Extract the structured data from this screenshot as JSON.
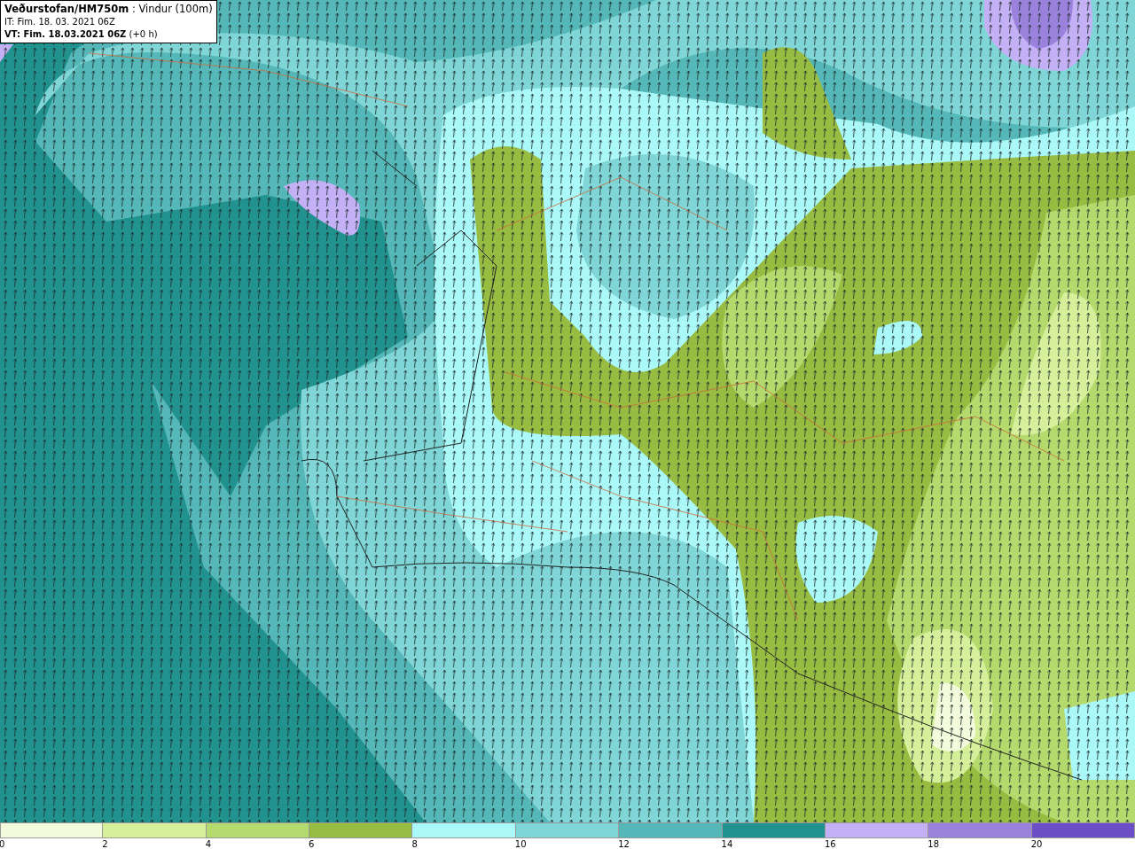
{
  "title_box": {
    "lines": [
      "**Veðurstofan/HM750m** : Vindur (100m)",
      "IT: Fim. 18. 03. 2021 06Z",
      "**VT: Fim. 18.03.2021 06Z** (+0 h)"
    ]
  },
  "legend": [
    {
      "label": "0",
      "color": "#f4fbdc"
    },
    {
      "label": "2",
      "color": "#d6ef9a"
    },
    {
      "label": "4",
      "color": "#b4d96c"
    },
    {
      "label": "6",
      "color": "#98bc42"
    },
    {
      "label": "8",
      "color": "#aaf8f8"
    },
    {
      "label": "10",
      "color": "#80d6d6"
    },
    {
      "label": "12",
      "color": "#55b7b7"
    },
    {
      "label": "14",
      "color": "#22928f"
    },
    {
      "label": "16",
      "color": "#c3b0f5"
    },
    {
      "label": "18",
      "color": "#9a82dc"
    },
    {
      "label": "20",
      "color": "#6c4ec6"
    }
  ]
}
